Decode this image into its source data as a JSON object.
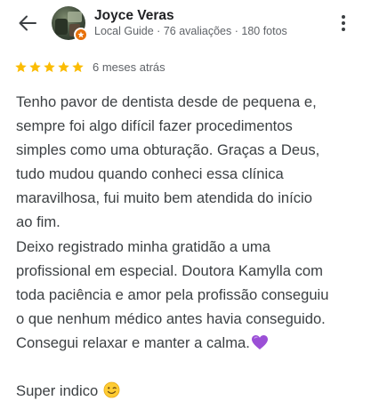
{
  "header": {
    "back_icon": "arrow-back-icon",
    "reviewer_name": "Joyce Veras",
    "reviewer_meta": "Local Guide · 76 avaliações · 180 fotos",
    "badge_icon": "local-guide-badge-icon",
    "menu_icon": "more-vert-icon"
  },
  "rating": {
    "stars": 5,
    "max_stars": 5,
    "star_color": "#fbbc04",
    "date": "6 meses atrás"
  },
  "review": {
    "lines": [
      "Tenho pavor de dentista desde de pequena e,",
      "sempre foi algo difícil fazer procedimentos",
      "simples como uma obturação. Graças a Deus,",
      "tudo mudou quando conheci essa clínica",
      "maravilhosa, fui muito bem atendida do início",
      "ao fim.",
      "Deixo registrado minha gratidão a uma",
      "profissional em especial. Doutora Kamylla com",
      "toda paciência e amor pela profissão conseguiu",
      "o que nenhum médico antes havia conseguido.",
      "Consegui relaxar e manter a calma.",
      "Super indico"
    ],
    "emoji_1": "purple-heart-icon",
    "emoji_2": "winking-face-icon"
  },
  "colors": {
    "text_primary": "#202124",
    "text_secondary": "#5f6368",
    "review_text": "#3c4043",
    "badge": "#e8710a",
    "heart": "#9b4fd6",
    "emoji_face": "#ffcc33"
  }
}
